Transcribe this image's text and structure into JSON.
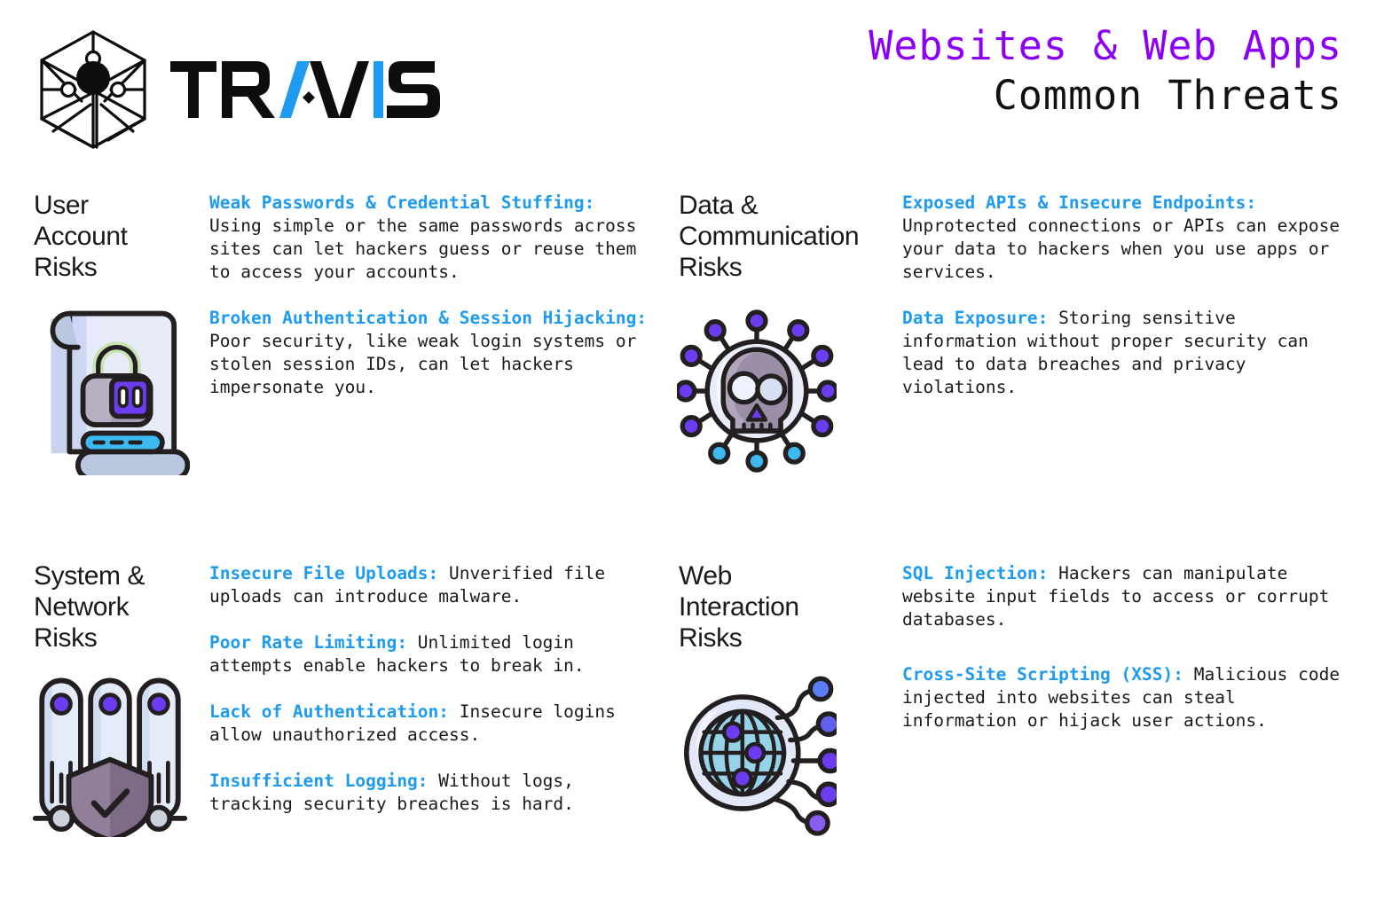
{
  "brand": {
    "name": "TRAVIS",
    "logo_icon": "hexagon-cube-node-logo",
    "wordmark_black": "TR",
    "wordmark_accent_a": "A",
    "wordmark_mid": "V",
    "wordmark_accent_i": "I",
    "wordmark_end": "S",
    "accent_color": "#1e9bf0"
  },
  "header": {
    "title_line1": "Websites & Web Apps",
    "title_line2": "Common Threats",
    "title_line1_color": "#8b00f5",
    "title_line2_color": "#111111"
  },
  "colors": {
    "lead_blue": "#1e9bf0",
    "title_purple": "#8b00f5",
    "body_black": "#1a1a1a",
    "icon_purple": "#6c3cf0",
    "icon_cyan": "#3bb9f0",
    "icon_lavender": "#dfe3fa",
    "icon_grey": "#9a93a8",
    "icon_outline": "#231f20"
  },
  "sections": [
    {
      "id": "user-account-risks",
      "category": "User\nAccount\nRisks",
      "icon": "scroll-with-padlock-icon",
      "threats": [
        {
          "lead": "Weak Passwords & Credential Stuffing:",
          "body": " Using simple or the same passwords across sites can let hackers guess or reuse them to access your accounts."
        },
        {
          "lead": "Broken Authentication & Session Hijacking:",
          "body": " Poor security, like weak login systems or stolen session IDs, can let hackers impersonate you."
        }
      ]
    },
    {
      "id": "data-communication-risks",
      "category": "Data &\nCommunication\nRisks",
      "icon": "virus-skull-icon",
      "threats": [
        {
          "lead": "Exposed APIs & Insecure Endpoints:",
          "body": " Unprotected connections or APIs can expose your data to hackers when you use apps or services."
        },
        {
          "lead": "Data Exposure:",
          "body": " Storing sensitive information without proper security can lead to data breaches and privacy violations."
        }
      ]
    },
    {
      "id": "system-network-risks",
      "category": "System &\nNetwork\nRisks",
      "icon": "server-rack-shield-icon",
      "threats": [
        {
          "lead": "Insecure File Uploads:",
          "body": " Unverified file uploads can introduce malware."
        },
        {
          "lead": "Poor Rate Limiting:",
          "body": " Unlimited login attempts enable hackers to break in."
        },
        {
          "lead": "Lack of Authentication:",
          "body": " Insecure logins allow unauthorized access."
        },
        {
          "lead": "Insufficient Logging:",
          "body": " Without logs, tracking security breaches is hard."
        }
      ]
    },
    {
      "id": "web-interaction-risks",
      "category": "Web\nInteraction\nRisks",
      "icon": "globe-network-nodes-icon",
      "threats": [
        {
          "lead": "SQL Injection:",
          "body": " Hackers can manipulate website input fields to access or corrupt databases."
        },
        {
          "lead": "Cross-Site Scripting (XSS):",
          "body": " Malicious code injected into websites can steal information or hijack user actions."
        }
      ]
    }
  ]
}
